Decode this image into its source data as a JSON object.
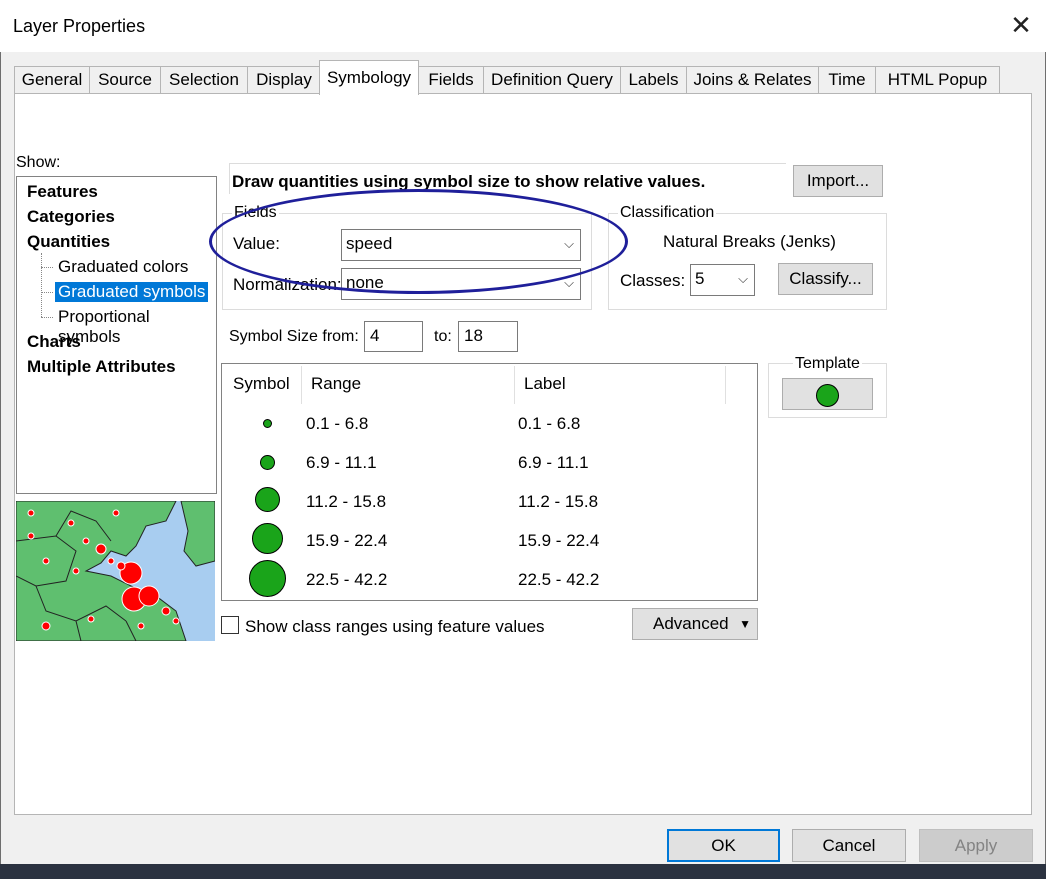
{
  "window": {
    "title": "Layer Properties",
    "close_glyph": "✕"
  },
  "tabs": [
    {
      "label": "General"
    },
    {
      "label": "Source"
    },
    {
      "label": "Selection"
    },
    {
      "label": "Display"
    },
    {
      "label": "Symbology",
      "active": true
    },
    {
      "label": "Fields"
    },
    {
      "label": "Definition Query"
    },
    {
      "label": "Labels"
    },
    {
      "label": "Joins & Relates"
    },
    {
      "label": "Time"
    },
    {
      "label": "HTML Popup"
    }
  ],
  "show": {
    "label": "Show:",
    "items": [
      {
        "label": "Features"
      },
      {
        "label": "Categories"
      },
      {
        "label": "Quantities"
      },
      {
        "label": "Graduated colors"
      },
      {
        "label": "Graduated symbols",
        "selected": true
      },
      {
        "label": "Proportional symbols"
      },
      {
        "label": "Charts"
      },
      {
        "label": "Multiple Attributes"
      }
    ]
  },
  "description": "Draw quantities using symbol size to show relative values.",
  "import_button": "Import...",
  "fields": {
    "group_label": "Fields",
    "value_label": "Value:",
    "value": "speed",
    "normalization_label": "Normalization:",
    "normalization": "none"
  },
  "classification": {
    "group_label": "Classification",
    "method": "Natural Breaks (Jenks)",
    "classes_label": "Classes:",
    "classes": "5",
    "classify_button": "Classify..."
  },
  "symbol_size": {
    "from_label": "Symbol Size from:",
    "from": "4",
    "to_label": "to:",
    "to": "18"
  },
  "table": {
    "headers": {
      "symbol": "Symbol",
      "range": "Range",
      "label": "Label"
    },
    "rows": [
      {
        "range": "0.1 - 6.8",
        "label": "0.1 - 6.8"
      },
      {
        "range": "6.9 - 11.1",
        "label": "6.9 - 11.1"
      },
      {
        "range": "11.2 - 15.8",
        "label": "11.2 - 15.8"
      },
      {
        "range": "15.9 - 22.4",
        "label": "15.9 - 22.4"
      },
      {
        "range": "22.5 - 42.2",
        "label": "22.5 - 42.2"
      }
    ]
  },
  "template_label": "Template",
  "show_class_ranges_label": "Show class ranges using feature values",
  "advanced_button": "Advanced",
  "footer": {
    "ok": "OK",
    "cancel": "Cancel",
    "apply": "Apply"
  },
  "colors": {
    "symbol_green": "#1aa41a",
    "selection_blue": "#0078d7",
    "annotation_ellipse": "#1f1f9a",
    "map_land": "#5fbf6f",
    "map_water": "#a8cdf0",
    "map_point": "#ff0000"
  }
}
